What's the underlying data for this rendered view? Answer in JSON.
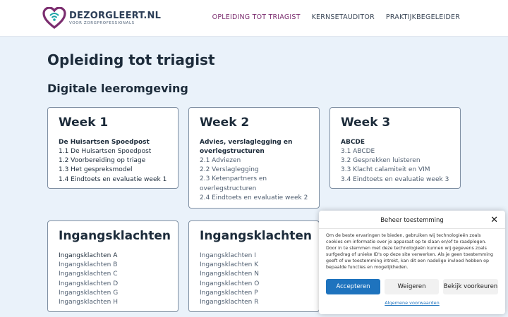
{
  "brand": {
    "name": "DEZORGLEERT.NL",
    "tagline": "VOOR ZORGPROFESSIONALS",
    "heart_color": "#7b2d6f",
    "accent_color": "#1ba3a6"
  },
  "nav": {
    "items": [
      {
        "label": "OPLEIDING TOT TRIAGIST",
        "active": true
      },
      {
        "label": "KERNSETAUDITOR",
        "active": false
      },
      {
        "label": "PRAKTIJKBEGELEIDER",
        "active": false
      }
    ]
  },
  "main": {
    "title": "Opleiding tot triagist",
    "subtitle": "Digitale leeromgeving"
  },
  "cards": [
    {
      "title": "Week 1",
      "subtitle": "De Huisartsen Spoedpost",
      "links": [
        "1.1 De Huisartsen Spoedpost",
        "1.2 Voorbereiding op triage",
        "1.3 Het gespreksmodel",
        "1.4 Eindtoets en evaluatie week 1"
      ]
    },
    {
      "title": "Week 2",
      "subtitle": "Advies, verslaglegging en overlegstructuren",
      "links": [
        "2.1 Adviezen",
        "2.2 Verslaglegging",
        "2.3 Ketenpartners en overlegstructuren",
        "2.4 Eindtoets en evaluatie week 2"
      ]
    },
    {
      "title": "Week 3",
      "subtitle": "ABCDE",
      "links": [
        "3.1 ABCDE",
        "3.2 Gesprekken luisteren",
        "3.3 Klacht calamiteit en VIM",
        "3.4 Eindtoets en evaluatie week 3"
      ]
    },
    {
      "title": "Ingangsklachten",
      "links": [
        "Ingangsklachten A",
        "Ingangsklachten B",
        "Ingangsklachten C",
        "Ingangsklachten D",
        "Ingangsklachten G",
        "Ingangsklachten H"
      ]
    },
    {
      "title": "Ingangsklachten",
      "links": [
        "Ingangsklachten I",
        "Ingangsklachten K",
        "Ingangsklachten N",
        "Ingangsklachten O",
        "Ingangsklachten P",
        "Ingangsklachten R"
      ]
    }
  ],
  "cookie": {
    "title": "Beheer toestemming",
    "text": "Om de beste ervaringen te bieden, gebruiken wij technologieën zoals cookies om informatie over je apparaat op te slaan en/of te raadplegen. Door in te stemmen met deze technologieën kunnen wij gegevens zoals surfgedrag of unieke ID's op deze site verwerken. Als je geen toestemming geeft of uw toestemming intrekt, kan dit een nadelige invloed hebben op bepaalde functies en mogelijkheden.",
    "accept_label": "Accepteren",
    "deny_label": "Weigeren",
    "prefs_label": "Bekijk voorkeuren",
    "footer_link": "Algemene voorwaarden",
    "accept_color": "#1e73be"
  }
}
